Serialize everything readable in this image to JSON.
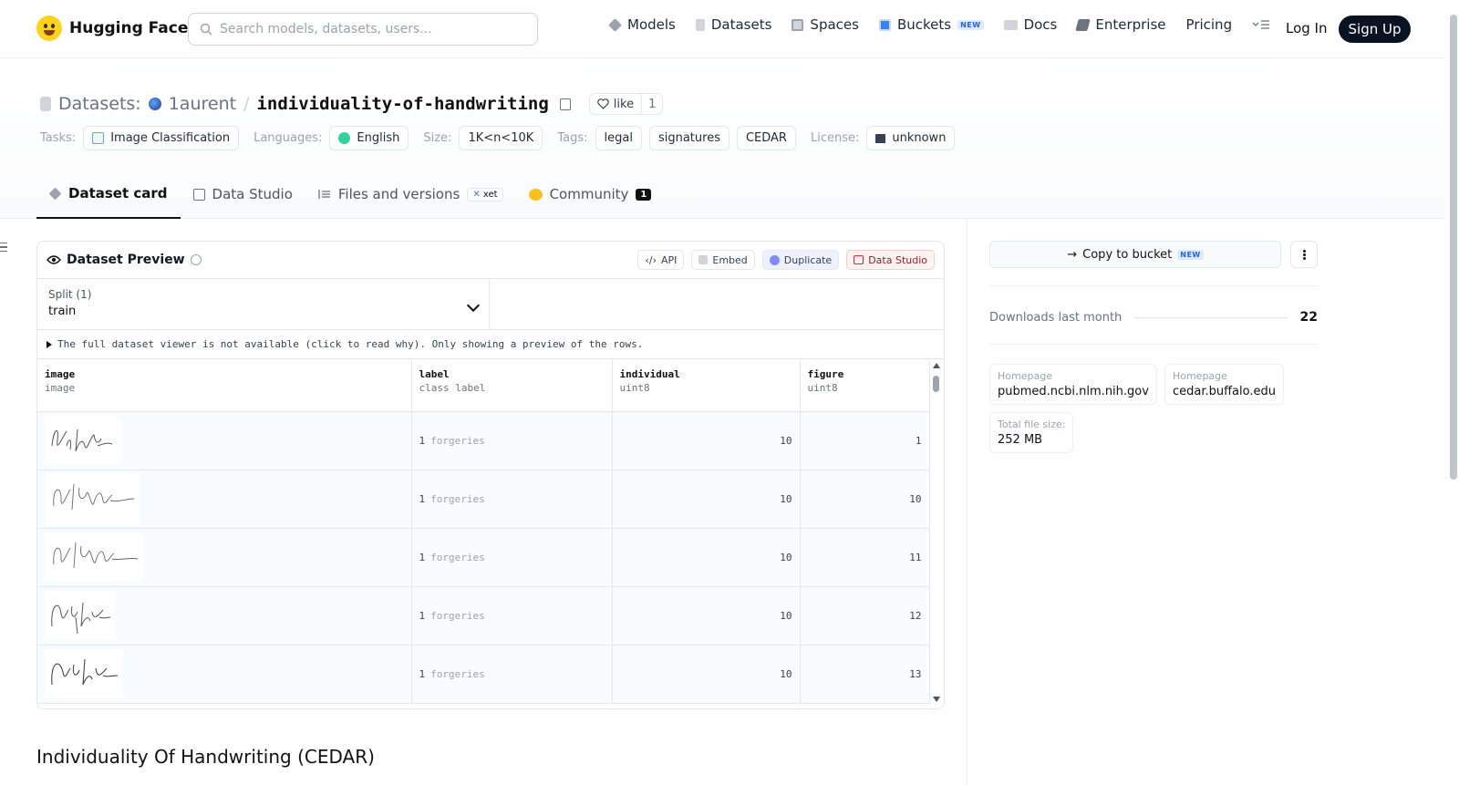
{
  "nav": {
    "brand": "Hugging Face",
    "search_placeholder": "Search models, datasets, users...",
    "links": {
      "models": "Models",
      "datasets": "Datasets",
      "spaces": "Spaces",
      "buckets": "Buckets",
      "buckets_badge": "NEW",
      "docs": "Docs",
      "enterprise": "Enterprise",
      "pricing": "Pricing"
    },
    "login": "Log In",
    "signup": "Sign Up"
  },
  "header": {
    "prefix": "Datasets:",
    "owner": "1aurent",
    "separator": "/",
    "name": "individuality-of-handwriting",
    "like_label": "like",
    "like_count": "1",
    "tags": {
      "tasks_label": "Tasks:",
      "task": "Image Classification",
      "languages_label": "Languages:",
      "language": "English",
      "size_label": "Size:",
      "size": "1K<n<10K",
      "tags_label": "Tags:",
      "tag1": "legal",
      "tag2": "signatures",
      "tag3": "CEDAR",
      "license_label": "License:",
      "license": "unknown"
    },
    "tabs": {
      "card": "Dataset card",
      "studio": "Data Studio",
      "files": "Files and versions",
      "files_badge": "xet",
      "community": "Community",
      "community_count": "1"
    }
  },
  "preview": {
    "title": "Dataset Preview",
    "actions": {
      "api": "API",
      "embed": "Embed",
      "duplicate": "Duplicate",
      "data_studio": "Data Studio"
    },
    "split_label": "Split (1)",
    "split_value": "train",
    "notice": "The full dataset viewer is not available (click to read why). Only showing a preview of the rows.",
    "columns": [
      {
        "name": "image",
        "type": "image"
      },
      {
        "name": "label",
        "type": "class label"
      },
      {
        "name": "individual",
        "type": "uint8"
      },
      {
        "name": "figure",
        "type": "uint8"
      }
    ],
    "rows": [
      {
        "label_id": "1",
        "label_name": "forgeries",
        "individual": "10",
        "figure": "1"
      },
      {
        "label_id": "1",
        "label_name": "forgeries",
        "individual": "10",
        "figure": "10"
      },
      {
        "label_id": "1",
        "label_name": "forgeries",
        "individual": "10",
        "figure": "11"
      },
      {
        "label_id": "1",
        "label_name": "forgeries",
        "individual": "10",
        "figure": "12"
      },
      {
        "label_id": "1",
        "label_name": "forgeries",
        "individual": "10",
        "figure": "13"
      }
    ]
  },
  "card_title": "Individuality Of Handwriting (CEDAR)",
  "sidebar": {
    "copy_bucket": "Copy to bucket",
    "copy_bucket_badge": "NEW",
    "downloads_label": "Downloads last month",
    "downloads_value": "22",
    "homepage1_label": "Homepage",
    "homepage1": "pubmed.ncbi.nlm.nih.gov",
    "homepage2_label": "Homepage",
    "homepage2": "cedar.buffalo.edu",
    "filesize_label": "Total file size:",
    "filesize": "252 MB"
  },
  "colors": {
    "accent_dark": "#0b1222",
    "brand_yellow": "#ffd21e",
    "new_badge": "#2563eb"
  }
}
